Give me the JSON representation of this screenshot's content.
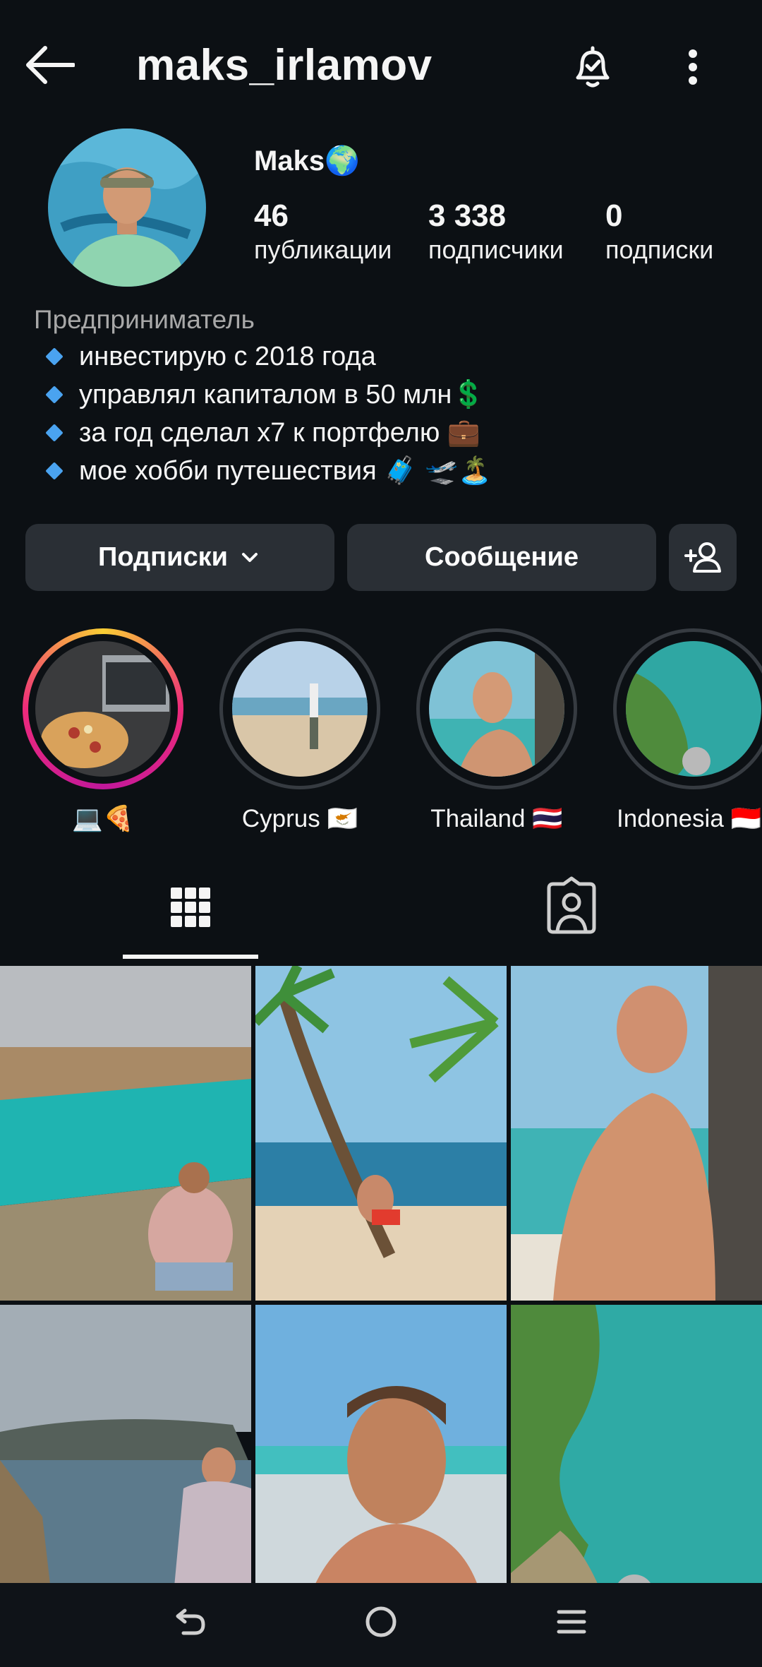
{
  "header": {
    "username": "maks_irlamov",
    "back_icon": "arrow-left-icon",
    "bell_icon": "bell-check-icon",
    "more_icon": "more-vertical-icon"
  },
  "profile": {
    "display_name": "Maks🌍",
    "stats": [
      {
        "value": "46",
        "label": "публикации"
      },
      {
        "value": "3 338",
        "label": "подписчики"
      },
      {
        "value": "0",
        "label": "подписки"
      }
    ],
    "bio_category": "Предприниматель",
    "bio_lines": [
      "инвестирую с 2018 года",
      "управлял капиталом в 50 млн💲",
      "за год сделал x7 к портфелю 💼",
      "мое хобби путешествия 🧳 🛫🏝️"
    ]
  },
  "actions": {
    "follow_label": "Подписки",
    "message_label": "Сообщение",
    "add_icon": "add-person-icon"
  },
  "highlights": [
    {
      "label": "💻🍕",
      "active": true
    },
    {
      "label": "Cyprus 🇨🇾",
      "active": false
    },
    {
      "label": "Thailand 🇹🇭",
      "active": false
    },
    {
      "label": "Indonesia 🇮🇩",
      "active": false
    }
  ],
  "tabs": [
    {
      "name": "grid-icon"
    },
    {
      "name": "tagged-icon"
    }
  ],
  "navbar": {
    "back": "nav-back-icon",
    "home": "nav-home-icon",
    "recents": "nav-recents-icon"
  },
  "colors": {
    "background": "#0c1014",
    "button": "#2a2f35",
    "story_ring_start": "#f9ce34",
    "story_ring_end": "#c1189b",
    "bullet": "#4aa3f0"
  }
}
